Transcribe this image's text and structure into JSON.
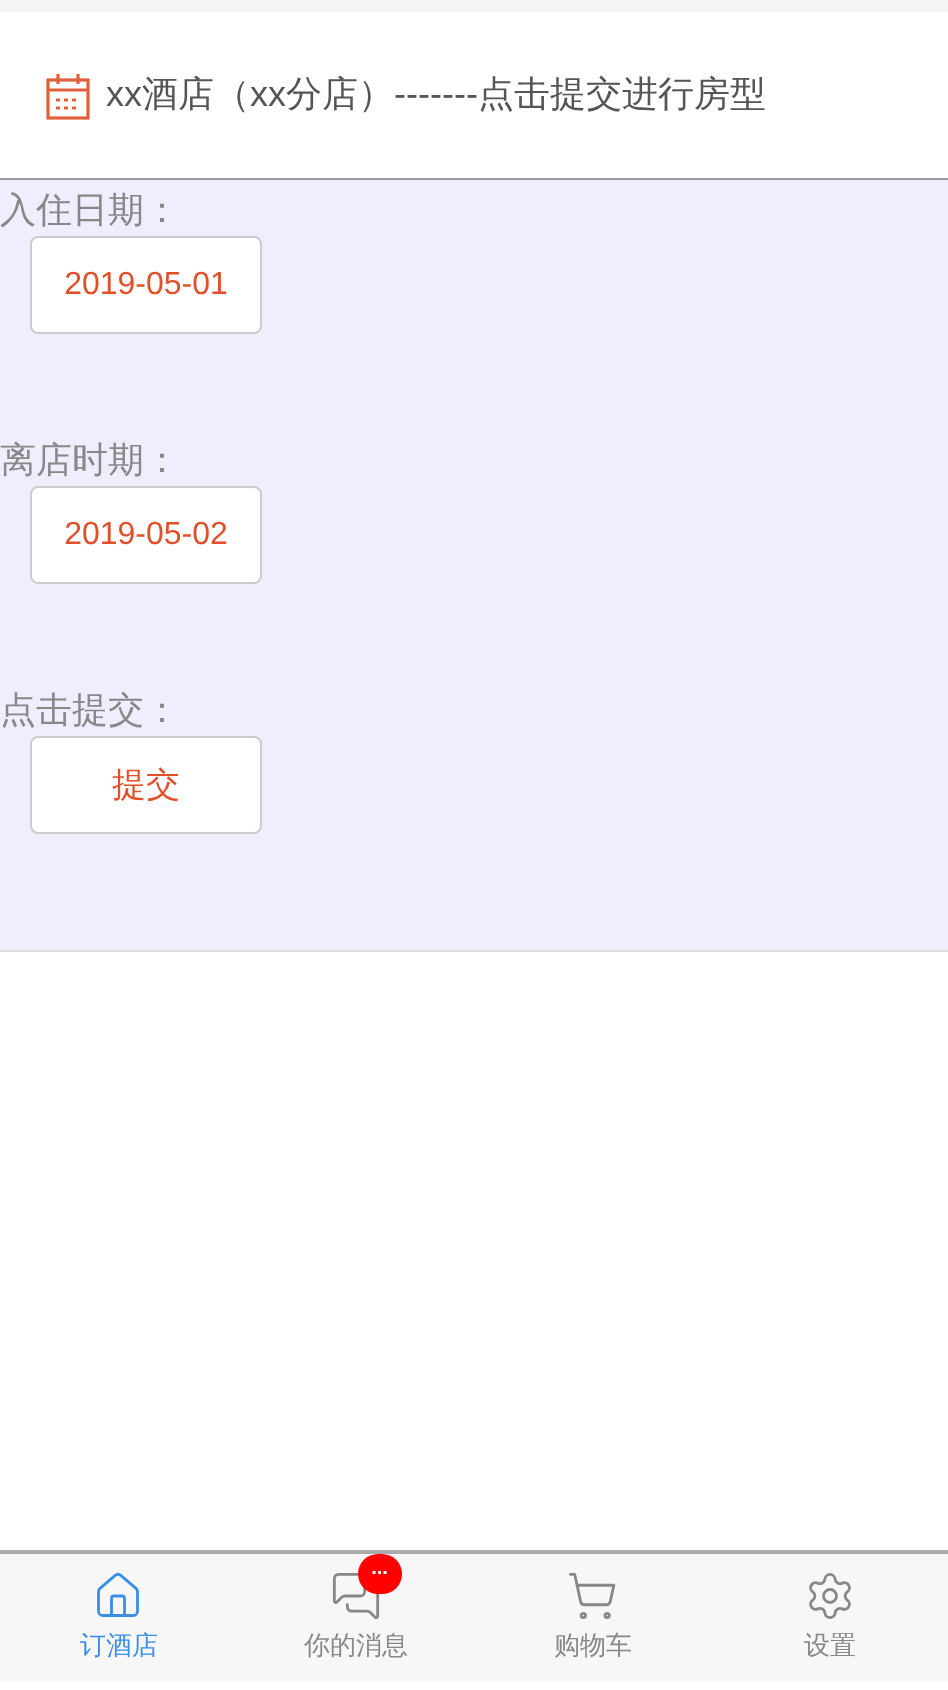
{
  "header": {
    "title": "xx酒店（xx分店）-------点击提交进行房型"
  },
  "form": [
    {
      "kind": "field",
      "label": "入住日期：",
      "value": "2019-05-01"
    },
    {
      "kind": "field",
      "label": "离店时期：",
      "value": "2019-05-02"
    },
    {
      "kind": "button",
      "label": "点击提交：",
      "value": "提交"
    }
  ],
  "tab_bar": [
    {
      "kind": "home",
      "label": "订酒店",
      "selected": true
    },
    {
      "kind": "messages",
      "label": "你的消息",
      "selected": false,
      "badge": "..."
    },
    {
      "kind": "cart",
      "label": "购物车",
      "selected": false
    },
    {
      "kind": "settings",
      "label": "设置",
      "selected": false
    }
  ]
}
